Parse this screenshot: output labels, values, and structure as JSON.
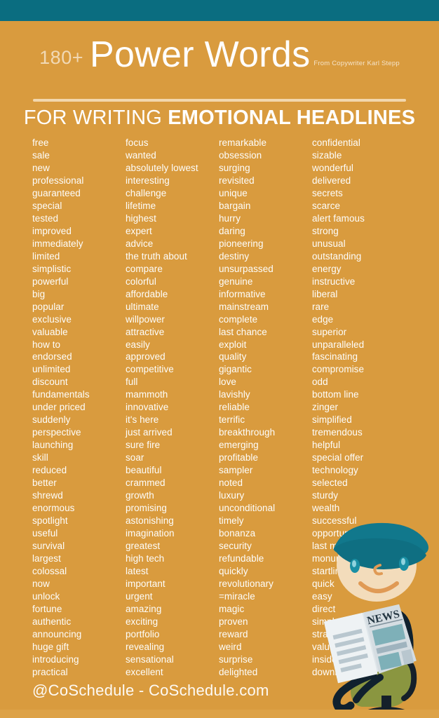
{
  "theme": {
    "header_bar_color": "#0a6d80",
    "background_color": "#d99b3e",
    "divider_color": "#f2d7ad",
    "text_color": "#fdfdfb",
    "hair_color": "#11788c",
    "skin_color": "#f3dcbb",
    "chair_color": "#8a9640",
    "suit_color": "#10212e",
    "tie_color": "#b4322f",
    "newspaper_color": "#e8edf0"
  },
  "header": {
    "count": "180+",
    "title": "Power Words",
    "attribution": "From Copywriter Karl Stepp",
    "subtitle_light": "FOR WRITING ",
    "subtitle_bold": "EMOTIONAL HEADLINES"
  },
  "columns": [
    {
      "id": "column-1",
      "words": [
        "free",
        "sale",
        "new",
        "professional",
        "guaranteed",
        "special",
        "tested",
        "improved",
        "immediately",
        "limited",
        "simplistic",
        "powerful",
        "big",
        "popular",
        "exclusive",
        "valuable",
        "how to",
        "endorsed",
        "unlimited",
        "discount",
        "fundamentals",
        "under priced",
        "suddenly",
        "perspective",
        "launching",
        "skill",
        "reduced",
        "better",
        "shrewd",
        "enormous",
        "spotlight",
        "useful",
        "survival",
        "largest",
        "colossal",
        "now",
        "unlock",
        "fortune",
        "authentic",
        "announcing",
        "huge gift",
        "introducing",
        "practical"
      ]
    },
    {
      "id": "column-2",
      "words": [
        "focus",
        "wanted",
        "absolutely lowest",
        "interesting",
        "challenge",
        "lifetime",
        "highest",
        "expert",
        "advice",
        "the truth about",
        "compare",
        "colorful",
        "affordable",
        "ultimate",
        "willpower",
        "attractive",
        "easily",
        "approved",
        "competitive",
        "full",
        "mammoth",
        "innovative",
        "it's here",
        "just arrived",
        "sure fire",
        "soar",
        "beautiful",
        "crammed",
        "growth",
        "promising",
        "astonishing",
        "imagination",
        "greatest",
        "high tech",
        "latest",
        "important",
        "urgent",
        "amazing",
        "exciting",
        "portfolio",
        "revealing",
        "sensational",
        "excellent"
      ]
    },
    {
      "id": "column-3",
      "words": [
        "remarkable",
        "obsession",
        "surging",
        "revisited",
        "unique",
        "bargain",
        "hurry",
        "daring",
        "pioneering",
        "destiny",
        "unsurpassed",
        "genuine",
        "informative",
        "mainstream",
        "complete",
        "last chance",
        "exploit",
        "quality",
        "gigantic",
        "love",
        "lavishly",
        "reliable",
        "terrific",
        "breakthrough",
        "emerging",
        "profitable",
        "sampler",
        "noted",
        "luxury",
        "unconditional",
        "timely",
        "bonanza",
        "security",
        "refundable",
        "quickly",
        "revolutionary",
        "=miracle",
        "magic",
        "proven",
        "reward",
        "weird",
        "surprise",
        "delighted"
      ]
    },
    {
      "id": "column-4",
      "words": [
        "confidential",
        "sizable",
        "wonderful",
        "delivered",
        "secrets",
        "scarce",
        "alert famous",
        "strong",
        "unusual",
        "outstanding",
        "energy",
        "instructive",
        "liberal",
        "rare",
        "edge",
        "superior",
        "unparalleled",
        "fascinating",
        "compromise",
        "odd",
        "bottom line",
        "zinger",
        "simplified",
        "tremendous",
        "helpful",
        "special offer",
        "technology",
        "selected",
        "sturdy",
        "wealth",
        "successful",
        "opportunities",
        "last minute",
        "monumental",
        "startling",
        "quick",
        "easy",
        "direct",
        "simple",
        "strange",
        "value",
        "insider",
        "download"
      ]
    }
  ],
  "footer": {
    "text": "@CoSchedule - CoSchedule.com"
  },
  "illustration": {
    "name": "man-reading-newspaper-in-office-chair",
    "newspaper_masthead": "NEWS"
  }
}
